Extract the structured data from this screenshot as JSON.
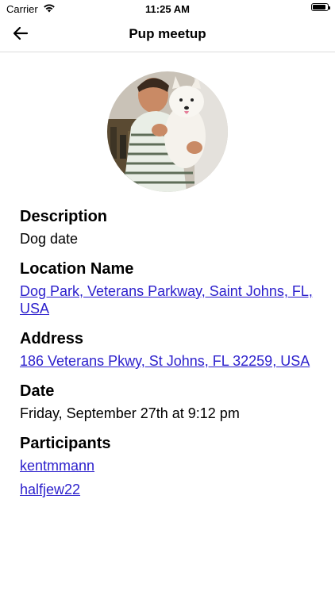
{
  "status_bar": {
    "carrier": "Carrier",
    "time": "11:25 AM",
    "battery_level": 0.9
  },
  "nav": {
    "title": "Pup meetup"
  },
  "event": {
    "description_label": "Description",
    "description": "Dog date",
    "location_label": "Location Name",
    "location": "Dog Park, Veterans Parkway, Saint Johns, FL, USA",
    "address_label": "Address",
    "address": "186 Veterans Pkwy, St Johns, FL 32259, USA",
    "date_label": "Date",
    "date": "Friday, September 27th at 9:12 pm",
    "participants_label": "Participants",
    "participants": [
      "kentmmann",
      "halfjew22"
    ]
  },
  "colors": {
    "link": "#2b1fcc",
    "divider": "#dcdcdc"
  }
}
